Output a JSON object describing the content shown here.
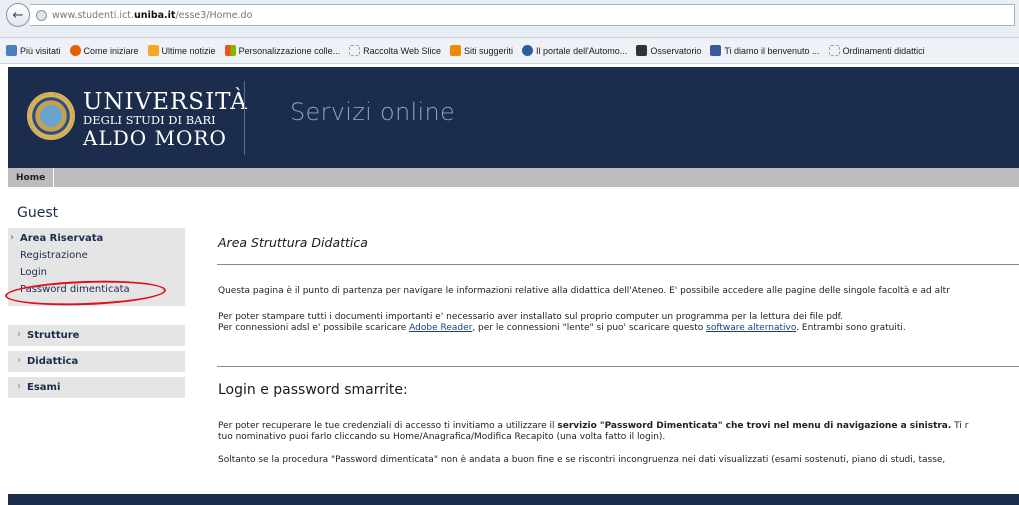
{
  "browser": {
    "url_prefix": "www.studenti.ict.",
    "url_domain": "uniba.it",
    "url_suffix": "/esse3/Home.do",
    "bookmarks": [
      {
        "label": "Più visitati",
        "icon": "most-visited-icon",
        "color": "#4a7ebf"
      },
      {
        "label": "Come iniziare",
        "icon": "firefox-icon",
        "color": "#e66000"
      },
      {
        "label": "Ultime notizie",
        "icon": "rss-icon",
        "color": "#f5a623"
      },
      {
        "label": "Personalizzazione colle...",
        "icon": "windows-icon",
        "color": "#2b8fd6"
      },
      {
        "label": "Raccolta Web Slice",
        "icon": "web-slice-icon",
        "color": "#9aa3ad"
      },
      {
        "label": "Siti suggeriti",
        "icon": "suggested-sites-icon",
        "color": "#f08a00"
      },
      {
        "label": "Il portale dell'Automo...",
        "icon": "portal-icon",
        "color": "#2c5e9e"
      },
      {
        "label": "Osservatorio",
        "icon": "observatory-icon",
        "color": "#333333"
      },
      {
        "label": "Ti diamo il benvenuto ...",
        "icon": "facebook-icon",
        "color": "#3b5998"
      },
      {
        "label": "Ordinamenti didattici",
        "icon": "page-icon",
        "color": "#9aa3ad"
      }
    ]
  },
  "header": {
    "logo_line1": "UNIVERSITÀ",
    "logo_line2": "DEGLI STUDI DI BARI",
    "logo_line3": "ALDO MORO",
    "service_title": "Servizi online"
  },
  "nav": {
    "home": "Home"
  },
  "sidebar": {
    "title": "Guest",
    "area_riservata": "Area Riservata",
    "items": [
      "Registrazione",
      "Login",
      "Password dimenticata"
    ],
    "sections": [
      "Strutture",
      "Didattica",
      "Esami"
    ]
  },
  "main": {
    "title": "Area Struttura Didattica",
    "intro": "Questa pagina è il punto di partenza per navigare le informazioni relative alla didattica dell'Ateneo. E' possibile accedere alle pagine delle singole facoltà e ad altr",
    "pdf_line1": "Per poter stampare tutti i documenti importanti e' necessario aver installato sul proprio computer un programma per la lettura dei file pdf.",
    "pdf_line2_a": "Per connessioni adsl e' possibile scaricare ",
    "pdf_link1": "Adobe Reader",
    "pdf_line2_b": ", per le connessioni \"lente\" si puo' scaricare questo ",
    "pdf_link2": "software alternativo",
    "pdf_line2_c": ". Entrambi sono gratuiti.",
    "login_title": "Login e password smarrite:",
    "recover_a": "Per poter recuperare le tue credenziali di accesso ti invitiamo a utilizzare il ",
    "recover_bold": "servizio \"Password Dimenticata\" che trovi nel menu di navigazione a sinistra.",
    "recover_b": " Ti r",
    "recover_line2": "tuo nominativo puoi farlo cliccando su Home/Anagrafica/Modifica Recapito (una volta fatto il login).",
    "last_para": "Soltanto se la procedura \"Password dimenticata\" non è andata a buon fine e se riscontri incongruenza nei dati visualizzati (esami sostenuti, piano di studi, tasse,"
  },
  "colors": {
    "header_bg": "#1b2c4c",
    "highlight": "#e0101a",
    "sidebar_bg": "#e5e5e5"
  }
}
